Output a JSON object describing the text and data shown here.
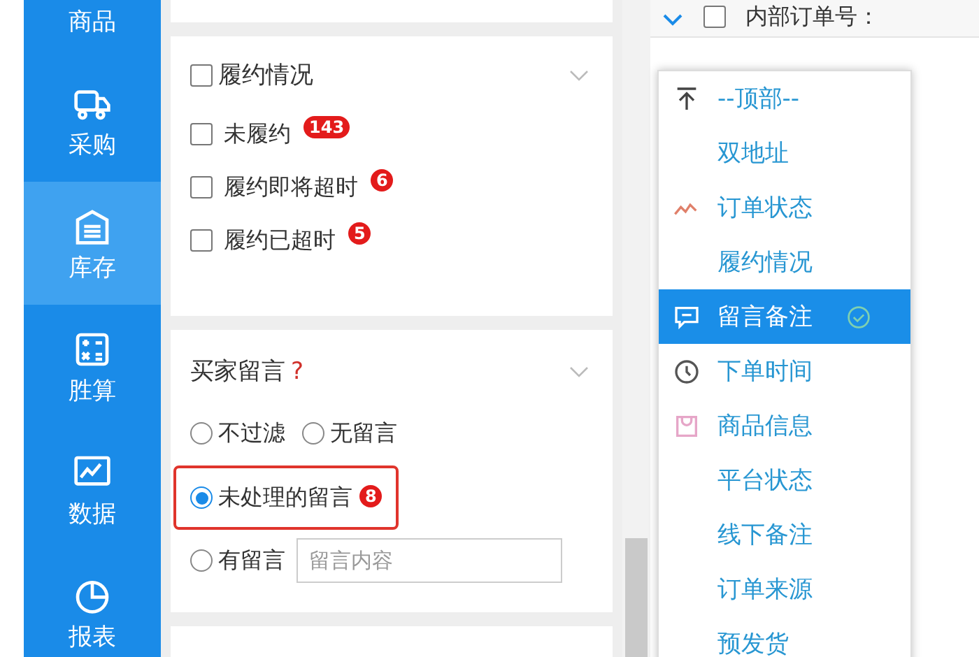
{
  "sidebar": {
    "items": [
      {
        "label": "商品",
        "selected": false
      },
      {
        "label": "采购",
        "selected": false
      },
      {
        "label": "库存",
        "selected": true
      },
      {
        "label": "胜算",
        "selected": false
      },
      {
        "label": "数据",
        "selected": false
      },
      {
        "label": "报表",
        "selected": false
      }
    ]
  },
  "fulfillment_filter": {
    "title": "履约情况",
    "checked": false,
    "options": [
      {
        "label": "未履约",
        "badge": "143",
        "checked": false
      },
      {
        "label": "履约即将超时",
        "badge": "6",
        "checked": false
      },
      {
        "label": "履约已超时",
        "badge": "5",
        "checked": false
      }
    ]
  },
  "buyer_message_filter": {
    "title": "买家留言",
    "help": "?",
    "options": [
      {
        "label": "不过滤",
        "selected": false,
        "kind": "inline"
      },
      {
        "label": "无留言",
        "selected": false,
        "kind": "inline"
      },
      {
        "label": "未处理的留言",
        "badge": "8",
        "selected": true,
        "kind": "highlighted"
      },
      {
        "label": "有留言",
        "selected": false,
        "kind": "with_field"
      }
    ],
    "field": {
      "placeholder": "留言内容"
    }
  },
  "table": {
    "select_all_checked": false,
    "columns": [
      {
        "label": "内部订单号："
      }
    ]
  },
  "column_menu": {
    "items": [
      {
        "label": "--顶部--",
        "selected": false
      },
      {
        "label": "双地址",
        "selected": false
      },
      {
        "label": "订单状态",
        "selected": false
      },
      {
        "label": "履约情况",
        "selected": false
      },
      {
        "label": "留言备注",
        "selected": true
      },
      {
        "label": "下单时间",
        "selected": false
      },
      {
        "label": "商品信息",
        "selected": false
      },
      {
        "label": "平台状态",
        "selected": false
      },
      {
        "label": "线下备注",
        "selected": false
      },
      {
        "label": "订单来源",
        "selected": false
      },
      {
        "label": "预发货",
        "selected": false
      }
    ]
  }
}
